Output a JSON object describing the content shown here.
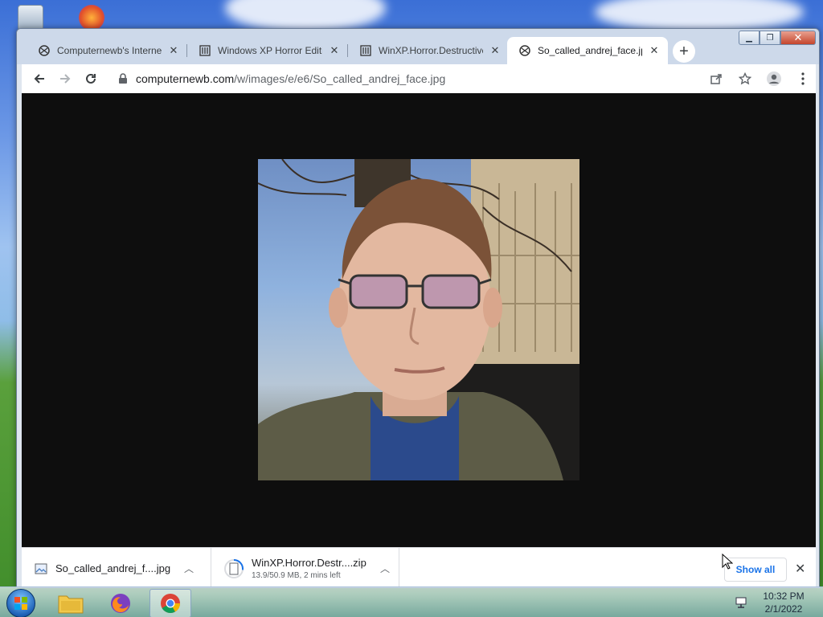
{
  "browser": {
    "tabs": [
      {
        "title": "Computernewb's Internet",
        "icon": "coat-of-arms-favicon",
        "active": false
      },
      {
        "title": "Windows XP Horror Editi",
        "icon": "museum-favicon",
        "active": false
      },
      {
        "title": "WinXP.Horror.Destructive",
        "icon": "museum-favicon",
        "active": false
      },
      {
        "title": "So_called_andrej_face.jpg",
        "icon": "coat-of-arms-favicon",
        "active": true
      }
    ],
    "address": {
      "host": "computernewb.com",
      "path": "/w/images/e/e6/So_called_andrej_face.jpg"
    },
    "image": {
      "description_icon": "photo-of-man-with-glasses"
    }
  },
  "downloads": {
    "items": [
      {
        "name": "So_called_andrej_f....jpg",
        "status": "",
        "icon": "image-file-icon"
      },
      {
        "name": "WinXP.Horror.Destr....zip",
        "status": "13.9/50.9 MB, 2 mins left",
        "icon": "zip-file-icon",
        "progress": 0.27
      }
    ],
    "show_all": "Show all"
  },
  "taskbar": {
    "time": "10:32 PM",
    "date": "2/1/2022"
  }
}
